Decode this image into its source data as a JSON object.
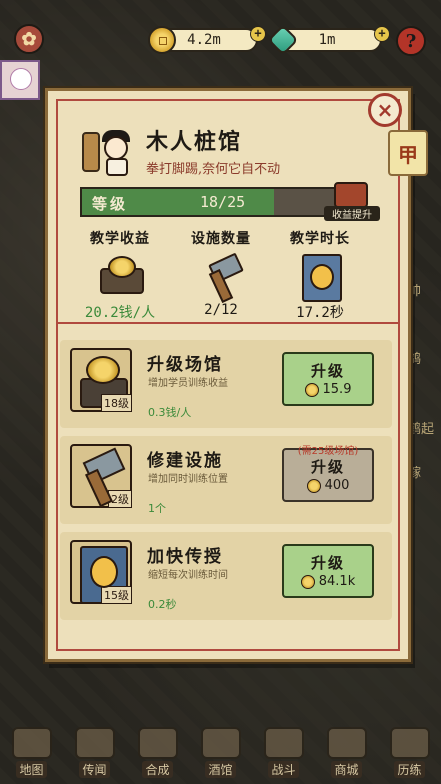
{
  "topbar": {
    "coins": "4.2m",
    "jade": "1m",
    "help_label": "?"
  },
  "avatar": {
    "label": ""
  },
  "panel": {
    "close_label": "×",
    "rank_tab": "甲",
    "title": "木人桩馆",
    "subtitle": "拳打脚踢,奈何它自不动",
    "level": {
      "label": "等级",
      "value": "18/25",
      "progress": 0.72,
      "boost_label": "收益提升"
    },
    "stats": [
      {
        "title": "教学收益",
        "icon": "coin-chest-icon",
        "value": "20.2钱/人",
        "green": true
      },
      {
        "title": "设施数量",
        "icon": "hammer-icon",
        "value": "2/12",
        "green": false
      },
      {
        "title": "教学时长",
        "icon": "scroll-icon",
        "value": "17.2秒",
        "green": false
      }
    ],
    "upgrades": [
      {
        "title": "升级场馆",
        "desc": "增加学员训练收益",
        "value": "0.3钱/人",
        "badge": "18级",
        "button": {
          "label": "升级",
          "price": "15.9",
          "requirement": "",
          "disabled": false
        }
      },
      {
        "title": "修建设施",
        "desc": "增加同时训练位置",
        "value": "1个",
        "badge": "2级",
        "button": {
          "label": "升级",
          "price": "400",
          "requirement": "(需25级场馆)",
          "disabled": true
        }
      },
      {
        "title": "加快传授",
        "desc": "缩短每次训练时间",
        "value": "0.2秒",
        "badge": "15级",
        "button": {
          "label": "升级",
          "price": "84.1k",
          "requirement": "",
          "disabled": false
        }
      }
    ]
  },
  "bottom_nav": [
    "地图",
    "传闻",
    "合成",
    "酒馆",
    "战斗",
    "商城",
    "历练"
  ],
  "side_labels": [
    "鸽",
    "鹤起",
    "帅",
    "嫁"
  ]
}
